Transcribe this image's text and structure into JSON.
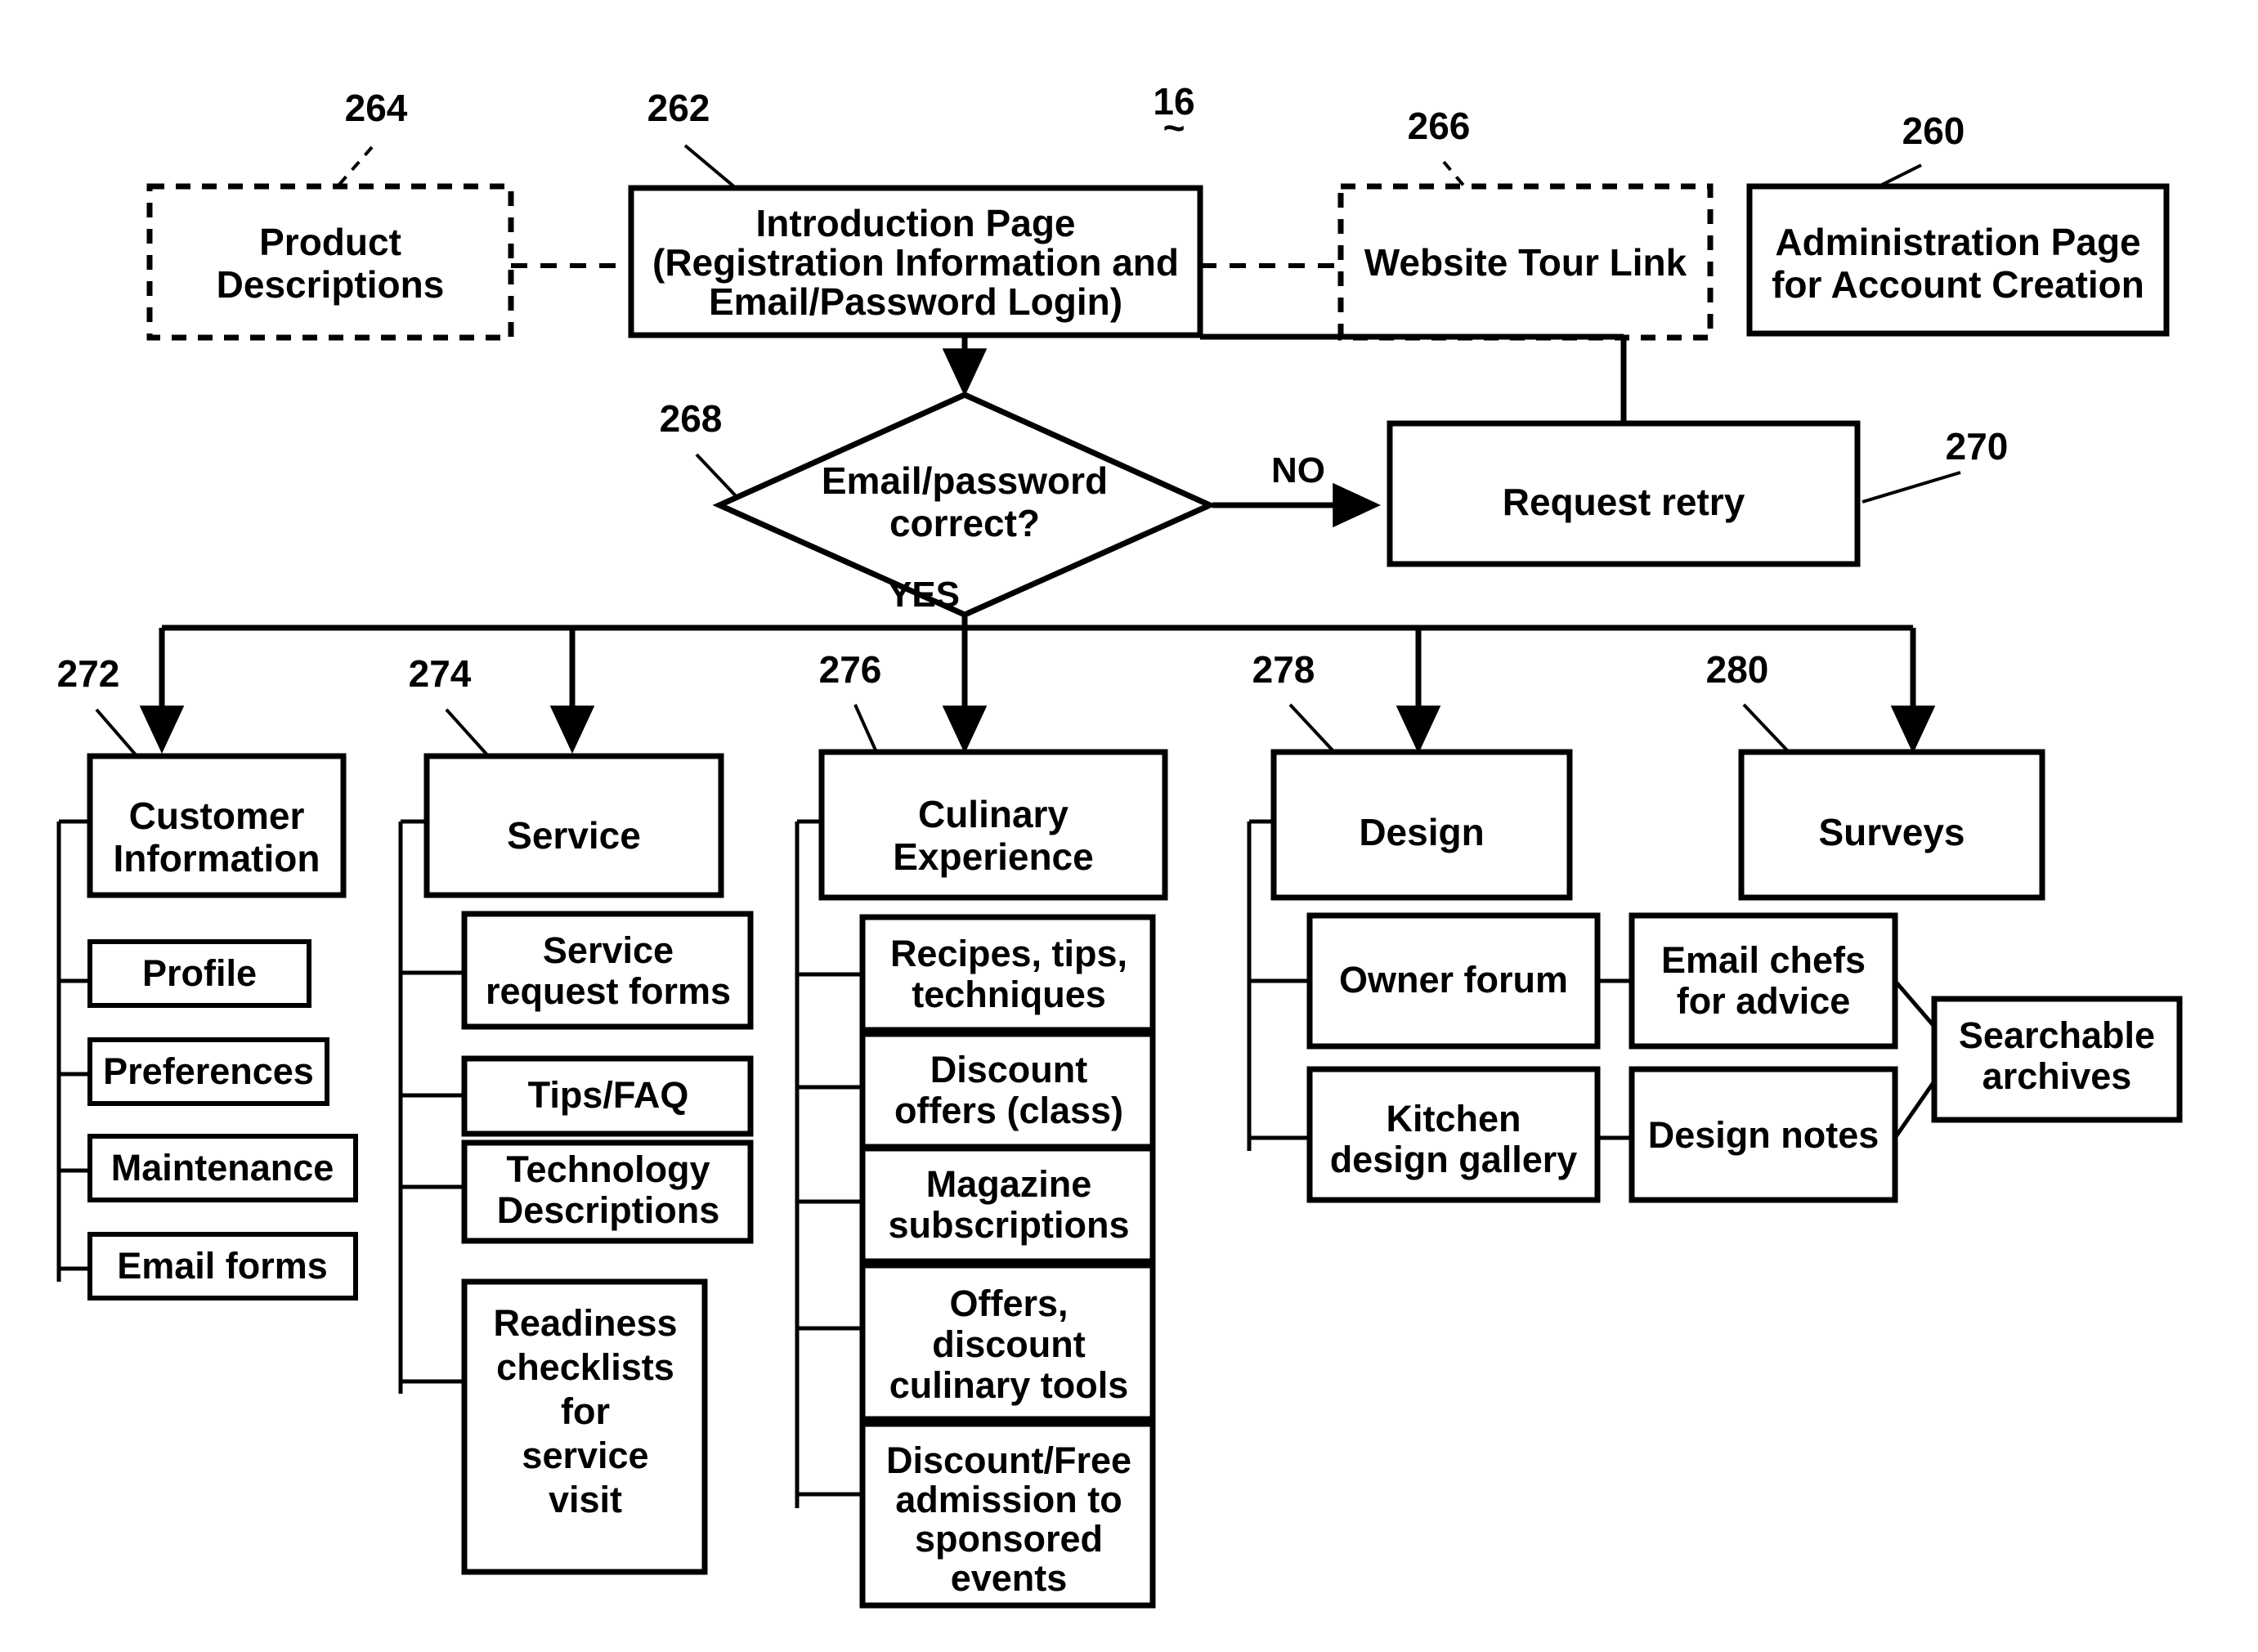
{
  "figure": {
    "label": "16",
    "tilde": "~"
  },
  "edge_labels": {
    "no": "NO",
    "yes": "YES"
  },
  "reference_numerals": {
    "product_descriptions": "264",
    "introduction_page": "262",
    "website_tour_link": "266",
    "administration_page": "260",
    "decision": "268",
    "request_retry": "270",
    "customer_information": "272",
    "service": "274",
    "culinary_experience": "276",
    "design": "278",
    "surveys": "280"
  },
  "nodes": {
    "product_descriptions": {
      "lines": [
        "Product",
        "Descriptions"
      ],
      "style": "dashed"
    },
    "introduction_page": {
      "lines": [
        "Introduction Page",
        "(Registration Information and",
        "Email/Password Login)"
      ],
      "style": "solid"
    },
    "website_tour_link": {
      "lines": [
        "Website Tour Link"
      ],
      "style": "dashed"
    },
    "administration_page": {
      "lines": [
        "Administration Page",
        "for Account Creation"
      ],
      "style": "solid"
    },
    "decision": {
      "lines": [
        "Email/password",
        "correct?"
      ],
      "style": "diamond"
    },
    "request_retry": {
      "lines": [
        "Request retry"
      ],
      "style": "solid"
    },
    "customer_information": {
      "lines": [
        "Customer",
        "Information"
      ],
      "style": "solid"
    },
    "service": {
      "lines": [
        "Service"
      ],
      "style": "solid"
    },
    "culinary_experience": {
      "lines": [
        "Culinary",
        "Experience"
      ],
      "style": "solid"
    },
    "design": {
      "lines": [
        "Design"
      ],
      "style": "solid"
    },
    "surveys": {
      "lines": [
        "Surveys"
      ],
      "style": "solid"
    }
  },
  "customer_information_children": [
    {
      "lines": [
        "Profile"
      ]
    },
    {
      "lines": [
        "Preferences"
      ]
    },
    {
      "lines": [
        "Maintenance"
      ]
    },
    {
      "lines": [
        "Email forms"
      ]
    }
  ],
  "service_children": [
    {
      "lines": [
        "Service",
        "request forms"
      ]
    },
    {
      "lines": [
        "Tips/FAQ"
      ]
    },
    {
      "lines": [
        "Technology",
        "Descriptions"
      ]
    },
    {
      "lines": [
        "Readiness",
        "checklists",
        "for",
        "service",
        "visit"
      ]
    }
  ],
  "culinary_children": [
    {
      "lines": [
        "Recipes, tips,",
        "techniques"
      ]
    },
    {
      "lines": [
        "Discount",
        "offers (class)"
      ]
    },
    {
      "lines": [
        "Magazine",
        "subscriptions"
      ]
    },
    {
      "lines": [
        "Offers,",
        "discount",
        "culinary tools"
      ]
    },
    {
      "lines": [
        "Discount/Free",
        "admission to",
        "sponsored",
        "events"
      ]
    }
  ],
  "design_children": [
    {
      "lines": [
        "Owner forum"
      ]
    },
    {
      "lines": [
        "Kitchen",
        "design gallery"
      ]
    }
  ],
  "design_grandchildren": [
    {
      "lines": [
        "Email chefs",
        "for advice"
      ]
    },
    {
      "lines": [
        "Design notes"
      ]
    }
  ],
  "design_archives": {
    "lines": [
      "Searchable",
      "archives"
    ]
  },
  "colors": {
    "stroke": "#000000",
    "fill": "#ffffff"
  }
}
